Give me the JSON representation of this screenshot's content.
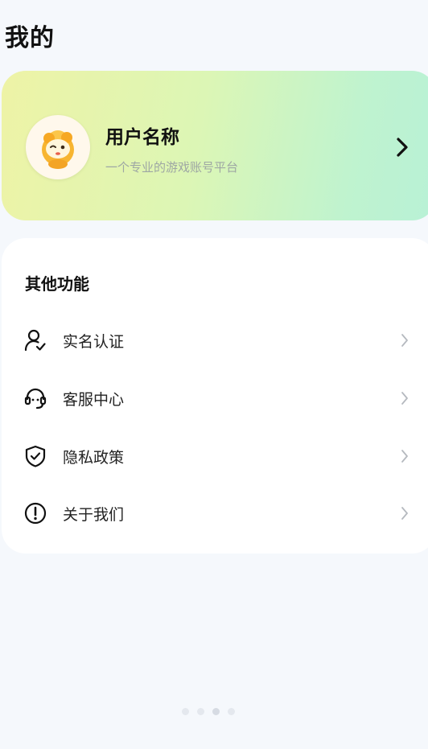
{
  "header": {
    "title": "我的"
  },
  "profile": {
    "username": "用户名称",
    "slogan": "一个专业的游戏账号平台",
    "avatar_icon": "cartoon-mascot-avatar",
    "chevron_icon": "chevron-right-icon",
    "gradient_colors": [
      "#eef3a6",
      "#dcf6b5",
      "#bff3cf"
    ]
  },
  "functions": {
    "title": "其他功能",
    "items": [
      {
        "label": "实名认证",
        "icon": "user-check-icon"
      },
      {
        "label": "客服中心",
        "icon": "headset-icon"
      },
      {
        "label": "隐私政策",
        "icon": "shield-check-icon"
      },
      {
        "label": "关于我们",
        "icon": "info-circle-icon"
      }
    ]
  },
  "pager": {
    "count": 4,
    "active": 2
  }
}
